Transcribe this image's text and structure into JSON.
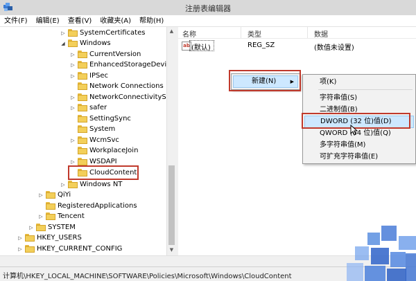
{
  "window": {
    "title": "注册表编辑器"
  },
  "menu": [
    "文件(F)",
    "编辑(E)",
    "查看(V)",
    "收藏夹(A)",
    "帮助(H)"
  ],
  "tree": {
    "items": [
      {
        "label": "SystemCertificates",
        "expander": "▷"
      },
      {
        "label": "Windows",
        "expander": "◢"
      },
      {
        "label": "CurrentVersion",
        "expander": "▷"
      },
      {
        "label": "EnhancedStorageDevices",
        "expander": "▷"
      },
      {
        "label": "IPSec",
        "expander": "▷"
      },
      {
        "label": "Network Connections",
        "expander": ""
      },
      {
        "label": "NetworkConnectivityStatu",
        "expander": "▷"
      },
      {
        "label": "safer",
        "expander": "▷"
      },
      {
        "label": "SettingSync",
        "expander": ""
      },
      {
        "label": "System",
        "expander": ""
      },
      {
        "label": "WcmSvc",
        "expander": "▷"
      },
      {
        "label": "WorkplaceJoin",
        "expander": ""
      },
      {
        "label": "WSDAPI",
        "expander": "▷"
      },
      {
        "label": "CloudContent",
        "expander": ""
      },
      {
        "label": "Windows NT",
        "expander": "▷"
      },
      {
        "label": "QiYi",
        "expander": "▷"
      },
      {
        "label": "RegisteredApplications",
        "expander": ""
      },
      {
        "label": "Tencent",
        "expander": "▷"
      },
      {
        "label": "SYSTEM",
        "expander": "▷"
      },
      {
        "label": "HKEY_USERS",
        "expander": "▷"
      },
      {
        "label": "HKEY_CURRENT_CONFIG",
        "expander": "▷"
      }
    ]
  },
  "list": {
    "headers": {
      "name": "名称",
      "type": "类型",
      "data": "数据"
    },
    "rows": [
      {
        "name": "(默认)",
        "type": "REG_SZ",
        "data": "(数值未设置)",
        "icon": "ab"
      }
    ]
  },
  "context_menu": {
    "new_label": "新建(N)",
    "arrow": "▶",
    "submenu": [
      "项(K)",
      "字符串值(S)",
      "二进制值(B)",
      "DWORD (32 位)值(D)",
      "QWORD (64 位)值(Q)",
      "多字符串值(M)",
      "可扩充字符串值(E)"
    ]
  },
  "statusbar": {
    "path": "计算机\\HKEY_LOCAL_MACHINE\\SOFTWARE\\Policies\\Microsoft\\Windows\\CloudContent"
  },
  "colors": {
    "highlight_border": "#c0392b",
    "menu_selected": "#cde8ff",
    "folder": "#f3cf5a"
  },
  "icons": {
    "app": "registry-editor-icon",
    "value": "string-value-icon",
    "folder": "folder-icon"
  }
}
